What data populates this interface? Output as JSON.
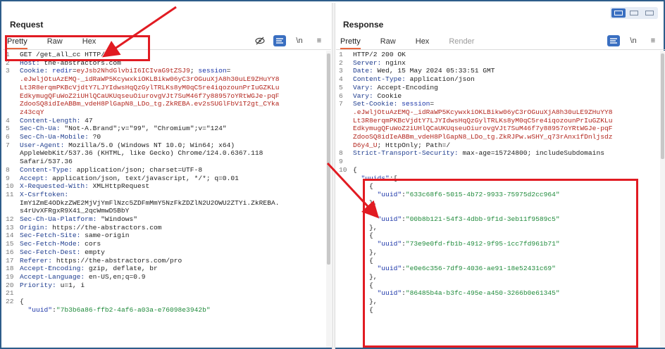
{
  "request": {
    "title": "Request",
    "tabs": [
      "Pretty",
      "Raw",
      "Hex"
    ],
    "toolbar": {
      "newline_label": "\\n",
      "menu_label": "≡"
    },
    "lines": [
      {
        "n": "1",
        "parts": [
          [
            "hv",
            "GET /get_all_cc HTTP/2"
          ]
        ]
      },
      {
        "n": "2",
        "parts": [
          [
            "hk",
            "Host: "
          ],
          [
            "hv",
            "the-abstractors.com"
          ]
        ]
      },
      {
        "n": "3",
        "parts": [
          [
            "hk",
            "Cookie: "
          ],
          [
            "blu",
            "redir"
          ],
          [
            "hv",
            "="
          ],
          [
            "red",
            "eyJsb2NhdGlvbiI6ICIvaG9tZSJ9"
          ],
          [
            "hv",
            "; "
          ],
          [
            "blu",
            "session"
          ],
          [
            "hv",
            "="
          ]
        ]
      },
      {
        "n": "",
        "parts": [
          [
            "red",
            ".eJwljOtuAzEMQ-_idRaWP5KcywxkiOKLBikw06yC3rOGuuXjA8h30uLE9ZHuYY8"
          ]
        ]
      },
      {
        "n": "",
        "parts": [
          [
            "red",
            "Lt3R8erqmPKBcVjdtY7LJYIdwsHqQzGylTRLKs8yM0qC5re4iqozounPrIuGZKLu"
          ]
        ]
      },
      {
        "n": "",
        "parts": [
          [
            "red",
            "EdkymugQFuWoZ2iUHlQCaUKUqseuOiurovgVJt7SuM46f7y88957oYRtWGJe-pqF"
          ]
        ]
      },
      {
        "n": "",
        "parts": [
          [
            "red",
            "ZdooSQ8idIeABBm_vdeH8PlGapN8_LDo_tg.ZkREBA.ev2sSUGlFbV1T2gt_CYka"
          ]
        ]
      },
      {
        "n": "",
        "parts": [
          [
            "red",
            "z43cqY"
          ]
        ]
      },
      {
        "n": "4",
        "parts": [
          [
            "hk",
            "Content-Length: "
          ],
          [
            "hv",
            "47"
          ]
        ]
      },
      {
        "n": "5",
        "parts": [
          [
            "hk",
            "Sec-Ch-Ua: "
          ],
          [
            "hv",
            "\"Not-A.Brand\";v=\"99\", \"Chromium\";v=\"124\""
          ]
        ]
      },
      {
        "n": "6",
        "parts": [
          [
            "hk",
            "Sec-Ch-Ua-Mobile: "
          ],
          [
            "hv",
            "?0"
          ]
        ]
      },
      {
        "n": "7",
        "parts": [
          [
            "hk",
            "User-Agent: "
          ],
          [
            "hv",
            "Mozilla/5.0 (Windows NT 10.0; Win64; x64)"
          ]
        ]
      },
      {
        "n": "",
        "parts": [
          [
            "hv",
            "AppleWebKit/537.36 (KHTML, like Gecko) Chrome/124.0.6367.118"
          ]
        ]
      },
      {
        "n": "",
        "parts": [
          [
            "hv",
            "Safari/537.36"
          ]
        ]
      },
      {
        "n": "8",
        "parts": [
          [
            "hk",
            "Content-Type: "
          ],
          [
            "hv",
            "application/json; charset=UTF-8"
          ]
        ]
      },
      {
        "n": "9",
        "parts": [
          [
            "hk",
            "Accept: "
          ],
          [
            "hv",
            "application/json, text/javascript, */*; q=0.01"
          ]
        ]
      },
      {
        "n": "10",
        "parts": [
          [
            "hk",
            "X-Requested-With: "
          ],
          [
            "hv",
            "XMLHttpRequest"
          ]
        ]
      },
      {
        "n": "11",
        "parts": [
          [
            "hk",
            "X-Csrftoken: "
          ]
        ]
      },
      {
        "n": "",
        "parts": [
          [
            "hv",
            "ImY1ZmE4ODkzZWE2MjVjYmFlNzc5ZDFmMmY5NzFkZDZlN2U2OWU2ZTYi.ZkREBA."
          ]
        ]
      },
      {
        "n": "",
        "parts": [
          [
            "hv",
            "s4rUvXFRgxR9X41_2qcWmwD5BbY"
          ]
        ]
      },
      {
        "n": "12",
        "parts": [
          [
            "hk",
            "Sec-Ch-Ua-Platform: "
          ],
          [
            "hv",
            "\"Windows\""
          ]
        ]
      },
      {
        "n": "13",
        "parts": [
          [
            "hk",
            "Origin: "
          ],
          [
            "hv",
            "https://the-abstractors.com"
          ]
        ]
      },
      {
        "n": "14",
        "parts": [
          [
            "hk",
            "Sec-Fetch-Site: "
          ],
          [
            "hv",
            "same-origin"
          ]
        ]
      },
      {
        "n": "15",
        "parts": [
          [
            "hk",
            "Sec-Fetch-Mode: "
          ],
          [
            "hv",
            "cors"
          ]
        ]
      },
      {
        "n": "16",
        "parts": [
          [
            "hk",
            "Sec-Fetch-Dest: "
          ],
          [
            "hv",
            "empty"
          ]
        ]
      },
      {
        "n": "17",
        "parts": [
          [
            "hk",
            "Referer: "
          ],
          [
            "hv",
            "https://the-abstractors.com/pro"
          ]
        ]
      },
      {
        "n": "18",
        "parts": [
          [
            "hk",
            "Accept-Encoding: "
          ],
          [
            "hv",
            "gzip, deflate, br"
          ]
        ]
      },
      {
        "n": "19",
        "parts": [
          [
            "hk",
            "Accept-Language: "
          ],
          [
            "hv",
            "en-US,en;q=0.9"
          ]
        ]
      },
      {
        "n": "20",
        "parts": [
          [
            "hk",
            "Priority: "
          ],
          [
            "hv",
            "u=1, i"
          ]
        ]
      },
      {
        "n": "21",
        "parts": [
          [
            "hv",
            ""
          ]
        ]
      },
      {
        "n": "22",
        "parts": [
          [
            "hv",
            "{"
          ]
        ]
      },
      {
        "n": "",
        "parts": [
          [
            "hv",
            "  "
          ],
          [
            "blu",
            "\"uuid\""
          ],
          [
            "hv",
            ":"
          ],
          [
            "grn",
            "\"7b3b6a86-ffb2-4af6-a03a-e76098e3942b\""
          ]
        ]
      }
    ]
  },
  "response": {
    "title": "Response",
    "tabs": [
      "Pretty",
      "Raw",
      "Hex",
      "Render"
    ],
    "toolbar": {
      "newline_label": "\\n",
      "menu_label": "≡"
    },
    "lines": [
      {
        "n": "1",
        "parts": [
          [
            "hv",
            "HTTP/2 200 OK"
          ]
        ]
      },
      {
        "n": "2",
        "parts": [
          [
            "hk",
            "Server: "
          ],
          [
            "hv",
            "nginx"
          ]
        ]
      },
      {
        "n": "3",
        "parts": [
          [
            "hk",
            "Date: "
          ],
          [
            "hv",
            "Wed, 15 May 2024 05:33:51 GMT"
          ]
        ]
      },
      {
        "n": "4",
        "parts": [
          [
            "hk",
            "Content-Type: "
          ],
          [
            "hv",
            "application/json"
          ]
        ]
      },
      {
        "n": "5",
        "parts": [
          [
            "hk",
            "Vary: "
          ],
          [
            "hv",
            "Accept-Encoding"
          ]
        ]
      },
      {
        "n": "6",
        "parts": [
          [
            "hk",
            "Vary: "
          ],
          [
            "hv",
            "Cookie"
          ]
        ]
      },
      {
        "n": "7",
        "parts": [
          [
            "hk",
            "Set-Cookie: "
          ],
          [
            "blu",
            "session"
          ],
          [
            "hv",
            "="
          ]
        ]
      },
      {
        "n": "",
        "parts": [
          [
            "red",
            ".eJwljOtuAzEMQ-_idRaWP5KcywxkiOKLBikw06yC3rOGuuXjA8h30uLE9ZHuYY8"
          ]
        ]
      },
      {
        "n": "",
        "parts": [
          [
            "red",
            "Lt3R8erqmPKBcVjdtY7LJYIdwsHqQzGylTRLKs8yM0qC5re4iqozounPrIuGZKLu"
          ]
        ]
      },
      {
        "n": "",
        "parts": [
          [
            "red",
            "EdkymugQFuWoZ2iUHlQCaUKUqseuOiurovgVJt7SuM46f7y88957oYRtWGJe-pqF"
          ]
        ]
      },
      {
        "n": "",
        "parts": [
          [
            "red",
            "ZdooSQ8idIeABBm_vdeH8PlGapN8_LDo_tg.ZkRJPw.wSHY_q73rAnx1fDnljsdz"
          ]
        ]
      },
      {
        "n": "",
        "parts": [
          [
            "red",
            "D6y4_U"
          ],
          [
            "hv",
            "; HttpOnly; Path=/"
          ]
        ]
      },
      {
        "n": "8",
        "parts": [
          [
            "hk",
            "Strict-Transport-Security: "
          ],
          [
            "hv",
            "max-age=15724800; includeSubdomains"
          ]
        ]
      },
      {
        "n": "9",
        "parts": [
          [
            "hv",
            ""
          ]
        ]
      },
      {
        "n": "10",
        "parts": [
          [
            "hv",
            "{"
          ]
        ]
      },
      {
        "n": "",
        "parts": [
          [
            "hv",
            "  "
          ],
          [
            "blu",
            "\"uuids\""
          ],
          [
            "hv",
            ":["
          ]
        ]
      },
      {
        "n": "",
        "parts": [
          [
            "hv",
            "    {"
          ]
        ]
      },
      {
        "n": "",
        "parts": [
          [
            "hv",
            "      "
          ],
          [
            "blu",
            "\"uuid\""
          ],
          [
            "hv",
            ":"
          ],
          [
            "grn",
            "\"633c68f6-5015-4b72-9933-75975d2cc964\""
          ]
        ]
      },
      {
        "n": "",
        "parts": [
          [
            "hv",
            "    },"
          ]
        ]
      },
      {
        "n": "",
        "parts": [
          [
            "hv",
            "    {"
          ]
        ]
      },
      {
        "n": "",
        "parts": [
          [
            "hv",
            "      "
          ],
          [
            "blu",
            "\"uuid\""
          ],
          [
            "hv",
            ":"
          ],
          [
            "grn",
            "\"00b8b121-54f3-4dbb-9f1d-3eb11f9589c5\""
          ]
        ]
      },
      {
        "n": "",
        "parts": [
          [
            "hv",
            "    },"
          ]
        ]
      },
      {
        "n": "",
        "parts": [
          [
            "hv",
            "    {"
          ]
        ]
      },
      {
        "n": "",
        "parts": [
          [
            "hv",
            "      "
          ],
          [
            "blu",
            "\"uuid\""
          ],
          [
            "hv",
            ":"
          ],
          [
            "grn",
            "\"73e9e0fd-fb1b-4912-9f95-1cc7fd961b71\""
          ]
        ]
      },
      {
        "n": "",
        "parts": [
          [
            "hv",
            "    },"
          ]
        ]
      },
      {
        "n": "",
        "parts": [
          [
            "hv",
            "    {"
          ]
        ]
      },
      {
        "n": "",
        "parts": [
          [
            "hv",
            "      "
          ],
          [
            "blu",
            "\"uuid\""
          ],
          [
            "hv",
            ":"
          ],
          [
            "grn",
            "\"e0e6c356-7df9-4036-ae91-18e52431c69\""
          ]
        ]
      },
      {
        "n": "",
        "parts": [
          [
            "hv",
            "    },"
          ]
        ]
      },
      {
        "n": "",
        "parts": [
          [
            "hv",
            "    {"
          ]
        ]
      },
      {
        "n": "",
        "parts": [
          [
            "hv",
            "      "
          ],
          [
            "blu",
            "\"uuid\""
          ],
          [
            "hv",
            ":"
          ],
          [
            "grn",
            "\"86485b4a-b3fc-495e-a450-3266b0e61345\""
          ]
        ]
      },
      {
        "n": "",
        "parts": [
          [
            "hv",
            "    },"
          ]
        ]
      },
      {
        "n": "",
        "parts": [
          [
            "hv",
            "    {"
          ]
        ]
      }
    ]
  },
  "colors": {
    "annotation": "#e11b22",
    "header_key": "#1f3d8f",
    "cookie_value": "#b3261e",
    "json_key": "#1a34a8",
    "json_string": "#1e8a3a",
    "active_tab_underline": "#e8663d",
    "button_blue": "#3a6fc1"
  }
}
